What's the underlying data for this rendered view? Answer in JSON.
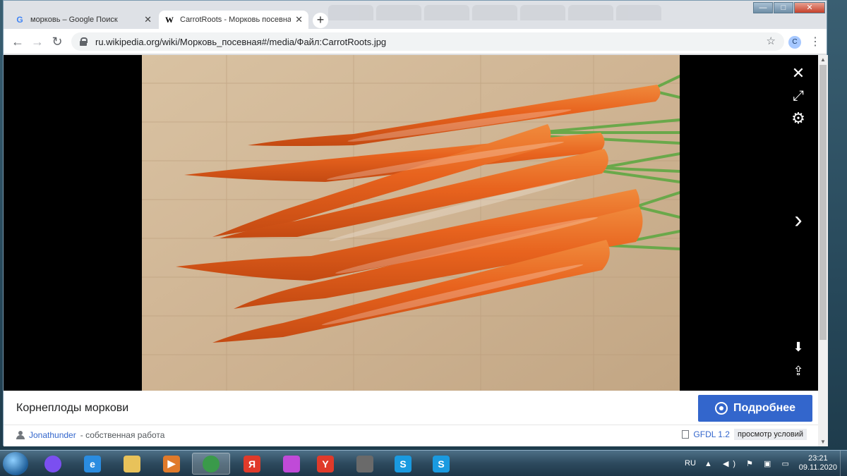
{
  "browser": {
    "tabs": [
      {
        "label": "морковь – Google Поиск",
        "favicon": "G",
        "active": false
      },
      {
        "label": "CarrotRoots - Морковь посевная",
        "favicon": "W",
        "active": true
      }
    ],
    "url": "ru.wikipedia.org/wiki/Морковь_посевная#/media/Файл:CarrotRoots.jpg",
    "profile_initial": "C",
    "window_controls": {
      "minimize": "—",
      "maximize": "□",
      "close": "✕"
    }
  },
  "viewer": {
    "controls_top": [
      "close-icon",
      "fullscreen-icon",
      "settings-icon"
    ],
    "next_icon": "chevron-right-icon",
    "controls_bottom": [
      "download-icon",
      "share-icon"
    ]
  },
  "info": {
    "title": "Корнеплоды моркови",
    "more_button": "Подробнее",
    "author": "Jonathunder",
    "author_suffix": "- собственная работа",
    "license": "GFDL 1.2",
    "terms": "просмотр условий"
  },
  "taskbar": {
    "items": [
      {
        "name": "alice",
        "glyph": "",
        "color": "#7b4ff0"
      },
      {
        "name": "ie",
        "glyph": "e",
        "color": "#2a8ce0"
      },
      {
        "name": "explorer",
        "glyph": "",
        "color": "#e8c25a"
      },
      {
        "name": "media",
        "glyph": "▶",
        "color": "#e07a2a"
      },
      {
        "name": "chrome",
        "glyph": "",
        "color": "#3a9a4a"
      },
      {
        "name": "yandex",
        "glyph": "Я",
        "color": "#e03a2a"
      },
      {
        "name": "app-purple",
        "glyph": "",
        "color": "#c04ad8"
      },
      {
        "name": "yandex-browser",
        "glyph": "Y",
        "color": "#e03a2a"
      },
      {
        "name": "app-terminal",
        "glyph": "",
        "color": "#6a6a6a"
      },
      {
        "name": "skype",
        "glyph": "S",
        "color": "#1a9ae0"
      },
      {
        "name": "skype2",
        "glyph": "S",
        "color": "#1a9ae0"
      }
    ],
    "language": "RU",
    "time": "23:21",
    "date": "09.11.2020"
  }
}
